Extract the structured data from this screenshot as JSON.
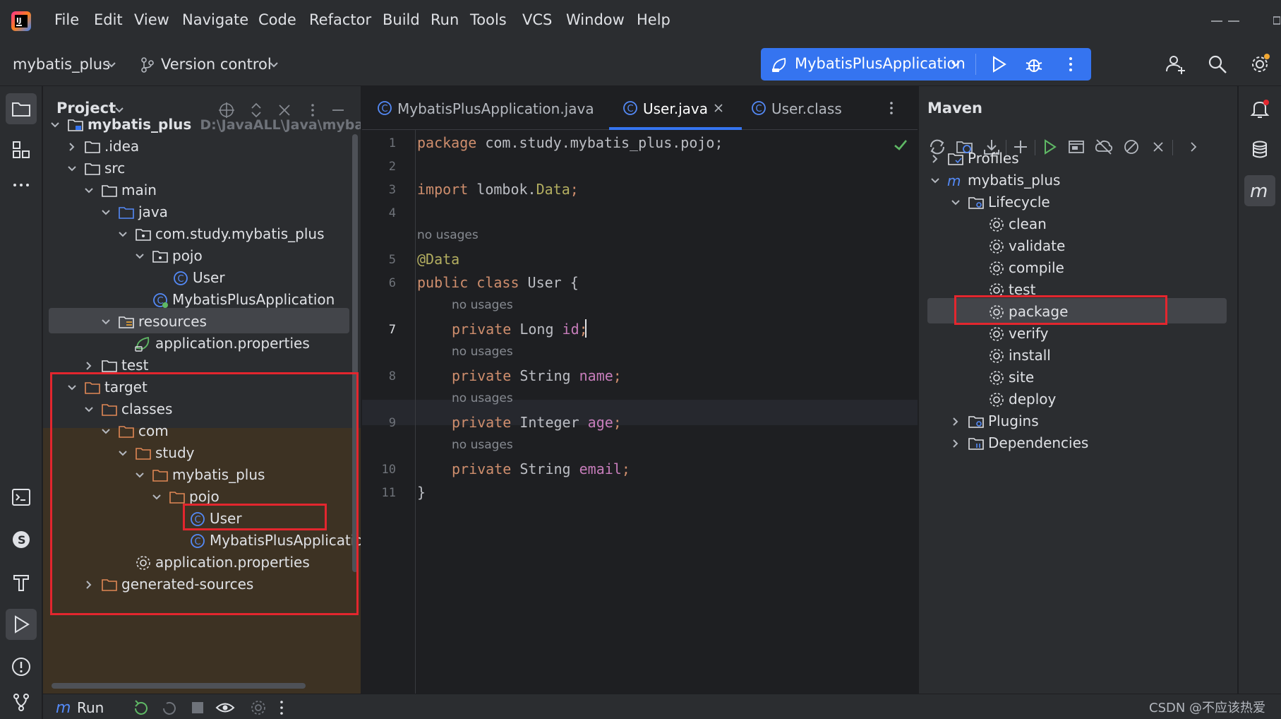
{
  "menu": [
    "File",
    "Edit",
    "View",
    "Navigate",
    "Code",
    "Refactor",
    "Build",
    "Run",
    "Tools",
    "VCS",
    "Window",
    "Help"
  ],
  "toolbar": {
    "project_name": "mybatis_plus",
    "vcs_label": "Version control",
    "run_config": "MybatisPlusApplication"
  },
  "project_panel": {
    "title": "Project",
    "root_label": "mybatis_plus",
    "root_path": "D:\\JavaALL\\Java\\mybatis_",
    "tree": [
      {
        "label": "mybatis_plus"
      },
      {
        "label": ".idea"
      },
      {
        "label": "src"
      },
      {
        "label": "main"
      },
      {
        "label": "java"
      },
      {
        "label": "com.study.mybatis_plus"
      },
      {
        "label": "pojo"
      },
      {
        "label": "User"
      },
      {
        "label": "MybatisPlusApplication"
      },
      {
        "label": "resources"
      },
      {
        "label": "application.properties"
      },
      {
        "label": "test"
      },
      {
        "label": "target"
      },
      {
        "label": "classes"
      },
      {
        "label": "com"
      },
      {
        "label": "study"
      },
      {
        "label": "mybatis_plus"
      },
      {
        "label": "pojo"
      },
      {
        "label": "User"
      },
      {
        "label": "MybatisPlusApplication"
      },
      {
        "label": "application.properties"
      },
      {
        "label": "generated-sources"
      }
    ]
  },
  "editor": {
    "tabs": [
      {
        "label": "MybatisPlusApplication.java"
      },
      {
        "label": "User.java"
      },
      {
        "label": "User.class"
      }
    ],
    "line_numbers": [
      "1",
      "2",
      "3",
      "4",
      "5",
      "6",
      "7",
      "8",
      "9",
      "10",
      "11"
    ],
    "hint": "no usages",
    "code": {
      "l1_kw": "package",
      "l1_rest": " com.study.mybatis_plus.pojo;",
      "l3_kw": "import",
      "l3_rest": " lombok.",
      "l3_ann": "Data",
      "l3_end": ";",
      "l5_ann": "@Data",
      "l6_kw": "public class",
      "l6_rest": " User {",
      "l7_kw": "private",
      "l7_type": " Long ",
      "l7_fld": "id",
      "l7_end": ";",
      "l8_kw": "private",
      "l8_type": " String ",
      "l8_fld": "name",
      "l8_end": ";",
      "l9_kw": "private",
      "l9_type": " Integer ",
      "l9_fld": "age",
      "l9_end": ";",
      "l10_kw": "private",
      "l10_type": " String ",
      "l10_fld": "email",
      "l10_end": ";",
      "l11": "}"
    }
  },
  "maven": {
    "title": "Maven",
    "tree": [
      {
        "label": "Profiles"
      },
      {
        "label": "mybatis_plus"
      },
      {
        "label": "Lifecycle"
      },
      {
        "label": "clean"
      },
      {
        "label": "validate"
      },
      {
        "label": "compile"
      },
      {
        "label": "test"
      },
      {
        "label": "package"
      },
      {
        "label": "verify"
      },
      {
        "label": "install"
      },
      {
        "label": "site"
      },
      {
        "label": "deploy"
      },
      {
        "label": "Plugins"
      },
      {
        "label": "Dependencies"
      }
    ]
  },
  "bottom": {
    "run_label": "Run",
    "watermark": "CSDN @不应该热爱"
  },
  "colors": {
    "accent": "#3574f0",
    "highlight_box": "#e3262e",
    "keyword": "#cf8e6d",
    "annotation": "#b3ae60",
    "field": "#c77dbb"
  }
}
